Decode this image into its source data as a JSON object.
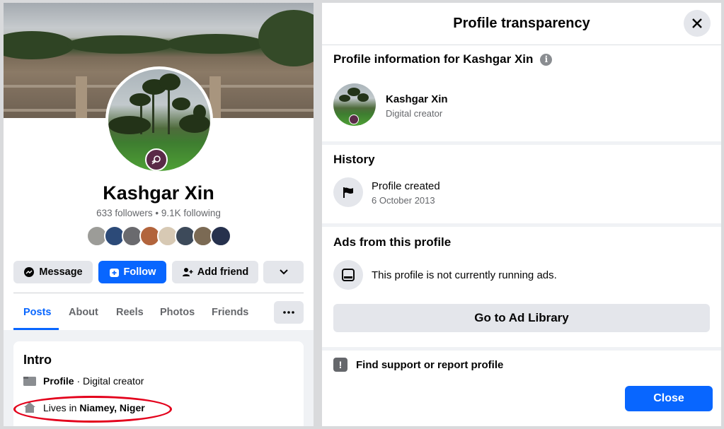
{
  "profile": {
    "name": "Kashgar Xin",
    "followers": "633 followers",
    "bullet": "•",
    "following": "9.1K following"
  },
  "actions": {
    "message": "Message",
    "follow": "Follow",
    "add_friend": "Add friend"
  },
  "tabs": [
    "Posts",
    "About",
    "Reels",
    "Photos",
    "Friends"
  ],
  "intro": {
    "title": "Intro",
    "profile_label": "Profile",
    "profile_sep": " · ",
    "profile_category": "Digital creator",
    "lives_prefix": "Lives in ",
    "lives_place": "Niamey, Niger"
  },
  "transparency": {
    "title": "Profile transparency",
    "info_heading": "Profile information for Kashgar Xin",
    "info_icon": "i",
    "name": "Kashgar Xin",
    "category": "Digital creator",
    "history_heading": "History",
    "history_event": "Profile created",
    "history_date": "6 October 2013",
    "ads_heading": "Ads from this profile",
    "ads_status": "This profile is not currently running ads.",
    "ad_library_button": "Go to Ad Library",
    "report_label": "Find support or report profile",
    "report_icon": "!",
    "close_button": "Close"
  },
  "colors": {
    "accent": "#0866ff",
    "highlight_ring": "#e3001b",
    "secondary_text": "#65676b"
  },
  "icons": [
    "messenger-icon",
    "follow-icon",
    "add-friend-icon",
    "chevron-down-icon",
    "more-icon",
    "profile-icon",
    "home-icon",
    "close-icon",
    "info-icon",
    "flag-icon",
    "ad-icon",
    "report-icon"
  ]
}
